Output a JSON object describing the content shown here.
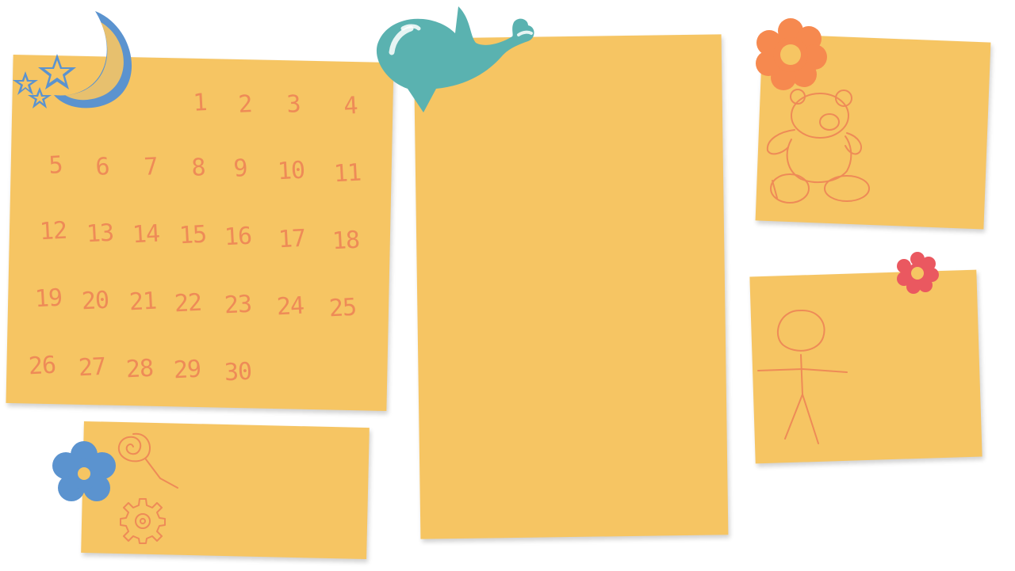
{
  "calendar": {
    "days": [
      "1",
      "2",
      "3",
      "4",
      "5",
      "6",
      "7",
      "8",
      "9",
      "10",
      "11",
      "12",
      "13",
      "14",
      "15",
      "16",
      "17",
      "18",
      "19",
      "20",
      "21",
      "22",
      "23",
      "24",
      "25",
      "26",
      "27",
      "28",
      "29",
      "30"
    ]
  },
  "colors": {
    "note": "#f6c563",
    "ink": "#ee8b57",
    "moon": "#5b93cf",
    "whale": "#5ab2b0",
    "flower_orange": "#f6894f",
    "flower_red": "#ea5860",
    "flower_blue": "#5b93cf"
  },
  "decorations": [
    "moon-stars-icon",
    "whale-icon",
    "orange-flower-icon",
    "red-flower-icon",
    "blue-flower-icon",
    "teddy-bear-doodle",
    "stick-figure-doodle",
    "lollipop-doodle",
    "gear-doodle"
  ]
}
